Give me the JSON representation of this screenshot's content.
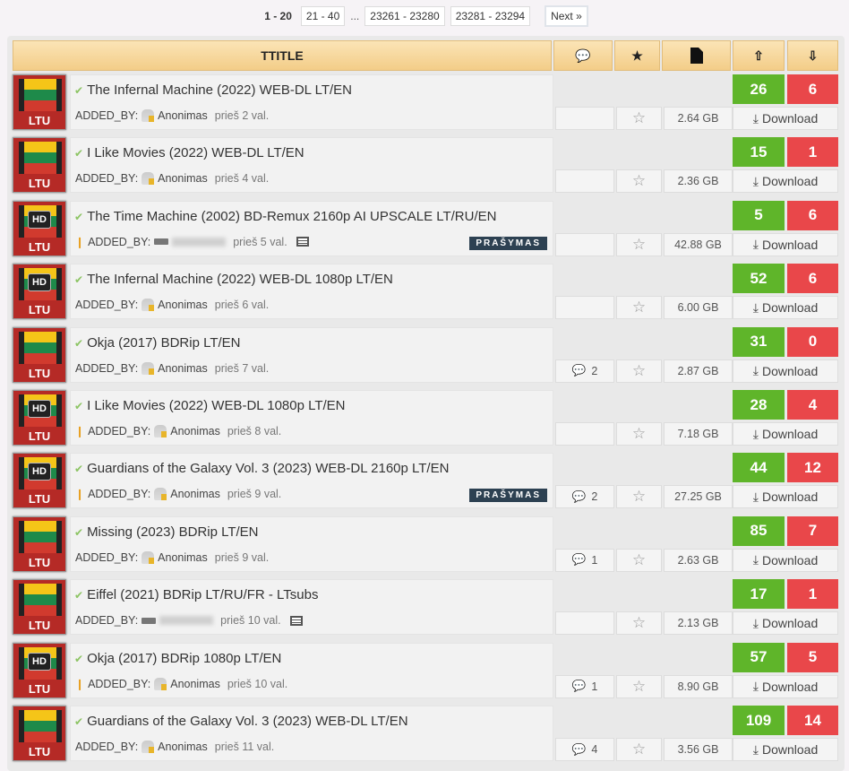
{
  "pagination": {
    "current": "1 - 20",
    "pages": [
      "21 - 40",
      "23261 - 23280",
      "23281 - 23294"
    ],
    "ellipsis": "...",
    "next": "Next »"
  },
  "header": {
    "title": "TTITLE",
    "comments_icon": "comment-icon",
    "favorite_icon": "star-icon",
    "size_icon": "file-icon",
    "seeders_icon": "cloud-upload-icon",
    "leechers_icon": "cloud-download-icon"
  },
  "labels": {
    "added_by": "ADDED_BY:",
    "download": "Download",
    "request_badge": "PRAŠYMAS",
    "category": "LTU",
    "hd": "HD"
  },
  "colors": {
    "seed": "#5fb52a",
    "leech": "#e9474a",
    "header": "#f3cd88"
  },
  "rows": [
    {
      "title": "The Infernal Machine (2022) WEB-DL LT/EN",
      "hd": false,
      "user": "Anonimas",
      "anon": true,
      "time": "prieš 2 val.",
      "comments": "",
      "size": "2.64 GB",
      "seeders": "26",
      "leechers": "6",
      "request": false,
      "therm": false,
      "nfo": false
    },
    {
      "title": "I Like Movies (2022) WEB-DL LT/EN",
      "hd": false,
      "user": "Anonimas",
      "anon": true,
      "time": "prieš 4 val.",
      "comments": "",
      "size": "2.36 GB",
      "seeders": "15",
      "leechers": "1",
      "request": false,
      "therm": false,
      "nfo": false
    },
    {
      "title": "The Time Machine (2002) BD-Remux 2160p AI UPSCALE LT/RU/EN",
      "hd": true,
      "user": "",
      "anon": false,
      "time": "prieš 5 val.",
      "comments": "",
      "size": "42.88 GB",
      "seeders": "5",
      "leechers": "6",
      "request": true,
      "therm": true,
      "nfo": true
    },
    {
      "title": "The Infernal Machine (2022) WEB-DL 1080p LT/EN",
      "hd": true,
      "user": "Anonimas",
      "anon": true,
      "time": "prieš 6 val.",
      "comments": "",
      "size": "6.00 GB",
      "seeders": "52",
      "leechers": "6",
      "request": false,
      "therm": false,
      "nfo": false
    },
    {
      "title": "Okja (2017) BDRip LT/EN",
      "hd": false,
      "user": "Anonimas",
      "anon": true,
      "time": "prieš 7 val.",
      "comments": "2",
      "size": "2.87 GB",
      "seeders": "31",
      "leechers": "0",
      "request": false,
      "therm": false,
      "nfo": false
    },
    {
      "title": "I Like Movies (2022) WEB-DL 1080p LT/EN",
      "hd": true,
      "user": "Anonimas",
      "anon": true,
      "time": "prieš 8 val.",
      "comments": "",
      "size": "7.18 GB",
      "seeders": "28",
      "leechers": "4",
      "request": false,
      "therm": true,
      "nfo": false
    },
    {
      "title": "Guardians of the Galaxy Vol. 3 (2023) WEB-DL 2160p LT/EN",
      "hd": true,
      "user": "Anonimas",
      "anon": true,
      "time": "prieš 9 val.",
      "comments": "2",
      "size": "27.25 GB",
      "seeders": "44",
      "leechers": "12",
      "request": true,
      "therm": true,
      "nfo": false
    },
    {
      "title": "Missing (2023) BDRip LT/EN",
      "hd": false,
      "user": "Anonimas",
      "anon": true,
      "time": "prieš 9 val.",
      "comments": "1",
      "size": "2.63 GB",
      "seeders": "85",
      "leechers": "7",
      "request": false,
      "therm": false,
      "nfo": false
    },
    {
      "title": "Eiffel (2021) BDRip LT/RU/FR - LTsubs",
      "hd": false,
      "user": "",
      "anon": false,
      "time": "prieš 10 val.",
      "comments": "",
      "size": "2.13 GB",
      "seeders": "17",
      "leechers": "1",
      "request": false,
      "therm": false,
      "nfo": true
    },
    {
      "title": "Okja (2017) BDRip 1080p LT/EN",
      "hd": true,
      "user": "Anonimas",
      "anon": true,
      "time": "prieš 10 val.",
      "comments": "1",
      "size": "8.90 GB",
      "seeders": "57",
      "leechers": "5",
      "request": false,
      "therm": true,
      "nfo": false
    },
    {
      "title": "Guardians of the Galaxy Vol. 3 (2023) WEB-DL LT/EN",
      "hd": false,
      "user": "Anonimas",
      "anon": true,
      "time": "prieš 11 val.",
      "comments": "4",
      "size": "3.56 GB",
      "seeders": "109",
      "leechers": "14",
      "request": false,
      "therm": false,
      "nfo": false
    }
  ]
}
